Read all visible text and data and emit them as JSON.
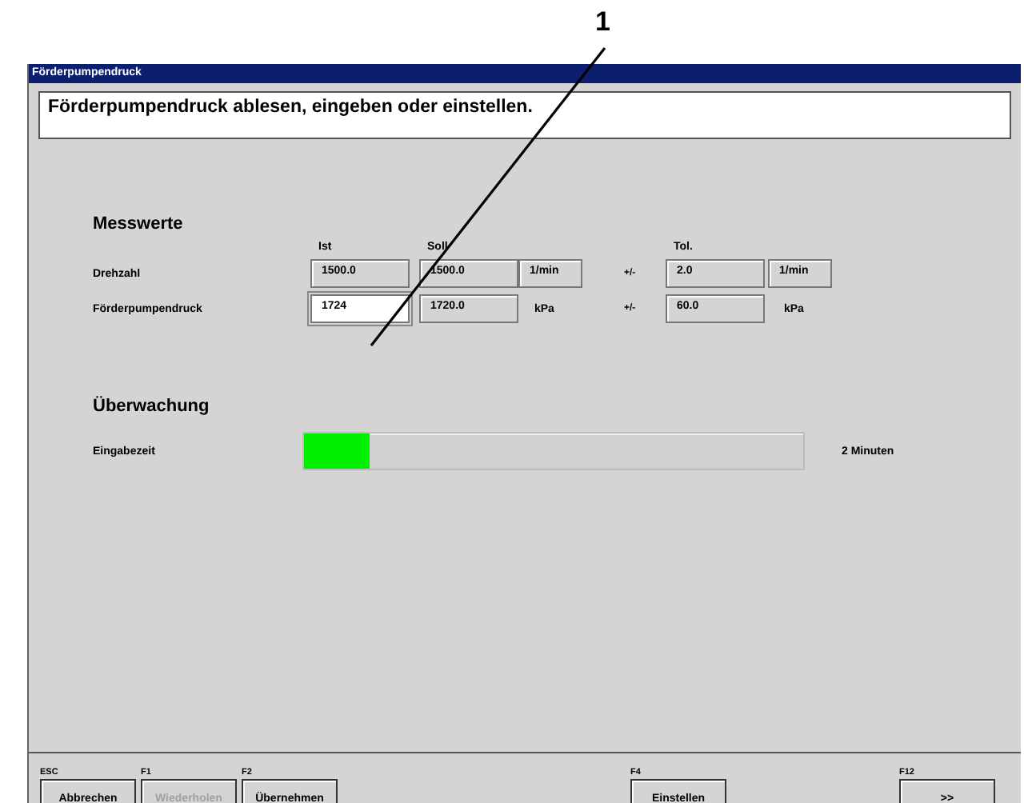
{
  "callout": {
    "label": "1"
  },
  "window": {
    "title": "Förderpumpendruck"
  },
  "instruction": "Förderpumpendruck ablesen, eingeben oder einstellen.",
  "measurements": {
    "title": "Messwerte",
    "columns": [
      "Ist",
      "Soll",
      "Tol."
    ],
    "rows": [
      {
        "label": "Drehzahl",
        "actual": {
          "value": "1500.0",
          "editable": false
        },
        "target": "1500.0",
        "unit": {
          "text": "1/min",
          "boxed": true
        },
        "plusminus": "+/-",
        "tolerance": "2.0",
        "tolerance_unit": {
          "text": "1/min",
          "boxed": true
        }
      },
      {
        "label": "Förderpumpendruck",
        "actual": {
          "value": "1724",
          "editable": true
        },
        "target": "1720.0",
        "unit": {
          "text": "kPa",
          "boxed": false
        },
        "plusminus": "+/-",
        "tolerance": "60.0",
        "tolerance_unit": {
          "text": "kPa",
          "boxed": false
        }
      }
    ]
  },
  "monitoring": {
    "title": "Überwachung",
    "label": "Eingabezeit",
    "level": 0.13,
    "reading": "2 Minuten"
  },
  "buttons": [
    {
      "key": "ESC",
      "label": "Abbrechen",
      "disabled": false
    },
    {
      "key": "F1",
      "label": "Wiederholen",
      "disabled": true
    },
    {
      "key": "F2",
      "label": "Übernehmen",
      "disabled": false
    },
    {
      "key": "F4",
      "label": "Einstellen",
      "disabled": false
    },
    {
      "key": "F12",
      "label": ">>",
      "disabled": false
    }
  ]
}
